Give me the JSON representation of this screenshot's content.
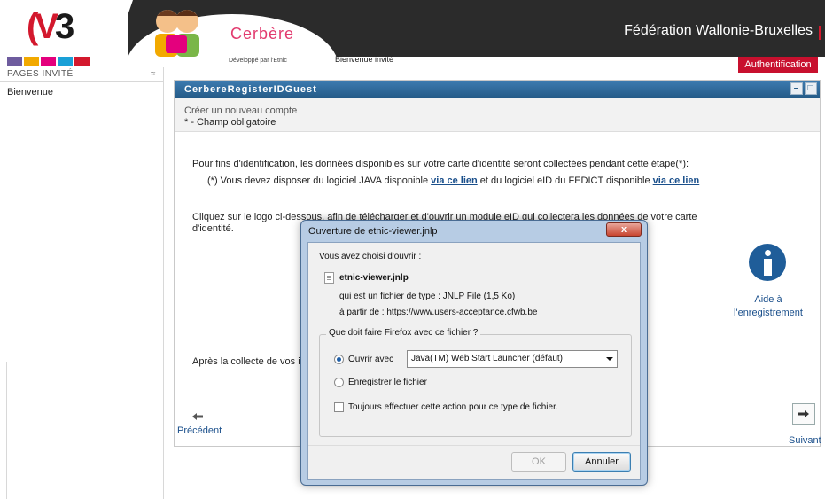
{
  "header": {
    "app_title": "Cerbère",
    "developed_by": "Développé par l'Etnic",
    "welcome": "Bienvenue invité",
    "organization": "Fédération Wallonie-Bruxelles",
    "auth_button": "Authentification",
    "brand_colors": [
      "#6e5c9e",
      "#f2a900",
      "#e4007d",
      "#1aa0d7",
      "#d3182d"
    ]
  },
  "sidebar": {
    "heading": "PAGES INVITÉ",
    "collapse_icon": "chevron-double-up-icon",
    "items": [
      {
        "label": "Bienvenue"
      }
    ]
  },
  "panel": {
    "title": "CerbereRegisterIDGuest",
    "subtitle": "Créer un nouveau compte",
    "required_note": "* - Champ obligatoire",
    "intro": "Pour fins d'identification, les données disponibles sur votre carte d'identité seront collectées pendant cette étape(*):",
    "note_prefix": "(*) Vous devez disposer du logiciel JAVA disponible",
    "link_1": "via ce lien",
    "note_mid": "et du logiciel eID du FEDICT disponible",
    "link_2": "via ce lien",
    "instruction_line1": "Cliquez sur le logo ci-dessous, afin de télécharger et d'ouvrir un module eID qui collectera les données de votre carte",
    "instruction_line2": "d'identité.",
    "after_text": "Après la collecte de vos in",
    "help_label_1": "Aide à",
    "help_label_2": "l'enregistrement",
    "prev_label": "Précédent",
    "next_label": "Suivant"
  },
  "dialog": {
    "title": "Ouverture de etnic-viewer.jnlp",
    "chosen": "Vous avez choisi d'ouvrir :",
    "filename": "etnic-viewer.jnlp",
    "file_type": "qui est un fichier de type : JNLP File (1,5 Ko)",
    "source": "à partir de : https://www.users-acceptance.cfwb.be",
    "question": "Que doit faire Firefox avec ce fichier ?",
    "open_with_label": "Ouvrir avec",
    "open_with_value": "Java(TM) Web Start Launcher (défaut)",
    "save_label": "Enregistrer le fichier",
    "always_label": "Toujours effectuer cette action pour ce type de fichier.",
    "ok": "OK",
    "cancel": "Annuler",
    "close": "x"
  }
}
